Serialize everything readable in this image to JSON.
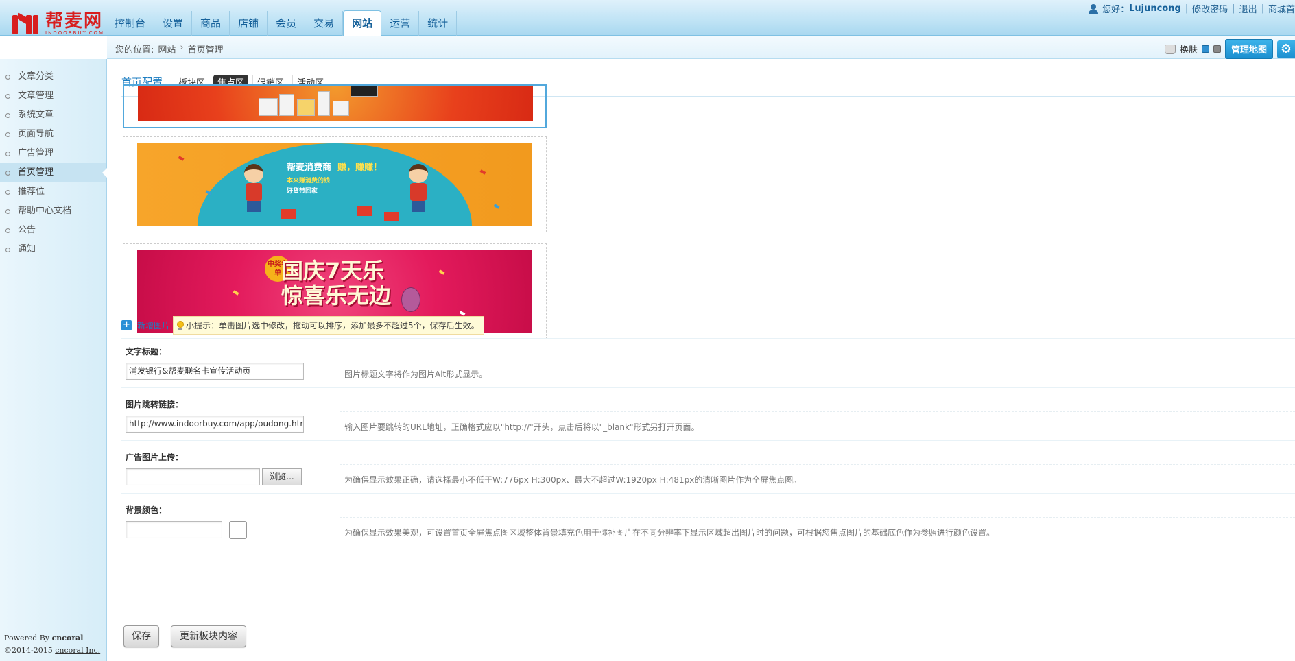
{
  "brand": {
    "name": "帮麦网",
    "sub": "INDOORBUY.COM"
  },
  "nav": [
    {
      "label": "控制台",
      "active": false
    },
    {
      "label": "设置",
      "active": false
    },
    {
      "label": "商品",
      "active": false
    },
    {
      "label": "店铺",
      "active": false
    },
    {
      "label": "会员",
      "active": false
    },
    {
      "label": "交易",
      "active": false
    },
    {
      "label": "网站",
      "active": true
    },
    {
      "label": "运营",
      "active": false
    },
    {
      "label": "统计",
      "active": false
    }
  ],
  "user_bar": {
    "greeting": "您好：",
    "user": "Lujuncong",
    "change_password": "修改密码",
    "logout": "退出",
    "store": "商城首"
  },
  "breadcrumb": {
    "prefix": "您的位置:",
    "level1": "网站",
    "sep": "›",
    "level2": "首页管理"
  },
  "toolbar": {
    "skin_label": "换肤",
    "map_button": "管理地图"
  },
  "sidebar": {
    "items": [
      {
        "label": "文章分类"
      },
      {
        "label": "文章管理"
      },
      {
        "label": "系统文章"
      },
      {
        "label": "页面导航"
      },
      {
        "label": "广告管理"
      },
      {
        "label": "首页管理",
        "active": true
      },
      {
        "label": "推荐位"
      },
      {
        "label": "帮助中心文档"
      },
      {
        "label": "公告"
      },
      {
        "label": "通知"
      }
    ],
    "footer": {
      "powered_by": "Powered By",
      "brand": "cncoral",
      "copyright": "©2014-2015",
      "company": "cncoral Inc."
    }
  },
  "tabs": {
    "title": "首页配置",
    "items": [
      "板块区",
      "焦点区",
      "促销区",
      "活动区"
    ],
    "active": "焦点区"
  },
  "banners": {
    "b2": {
      "line1a": "帮麦消费商",
      "line1b": "赚，赚赚！",
      "line2": "本来赚消费的钱",
      "line3": "好货带回家"
    },
    "b3": {
      "badge": "中奖名单",
      "line1": "国庆7天乐",
      "line2": "惊喜乐无边"
    }
  },
  "add_image": {
    "label": "新增图片",
    "tip": "小提示：单击图片选中修改，拖动可以排序，添加最多不超过5个，保存后生效。"
  },
  "form": {
    "title_label": "文字标题：",
    "title_value": "浦发银行&帮麦联名卡宣传活动页",
    "title_hint": "图片标题文字将作为图片Alt形式显示。",
    "link_label": "图片跳转链接：",
    "link_value": "http://www.indoorbuy.com/app/pudong.htm",
    "link_hint": "输入图片要跳转的URL地址，正确格式应以\"http://\"开头，点击后将以\"_blank\"形式另打开页面。",
    "upload_label": "广告图片上传：",
    "upload_value": "",
    "browse_label": "浏览...",
    "upload_hint": "为确保显示效果正确，请选择最小不低于W:776px H:300px、最大不超过W:1920px H:481px的清晰图片作为全屏焦点图。",
    "bg_label": "背景颜色：",
    "bg_value": "",
    "bg_hint": "为确保显示效果美观，可设置首页全屏焦点图区域整体背景填充色用于弥补图片在不同分辨率下显示区域超出图片时的问题，可根据您焦点图片的基础底色作为参照进行颜色设置。"
  },
  "actions": {
    "save": "保存",
    "update": "更新板块内容"
  },
  "colors": {
    "accent": "#1d7ec2",
    "header_bg": "#bfe3f5",
    "brand_red": "#d81e1e"
  }
}
